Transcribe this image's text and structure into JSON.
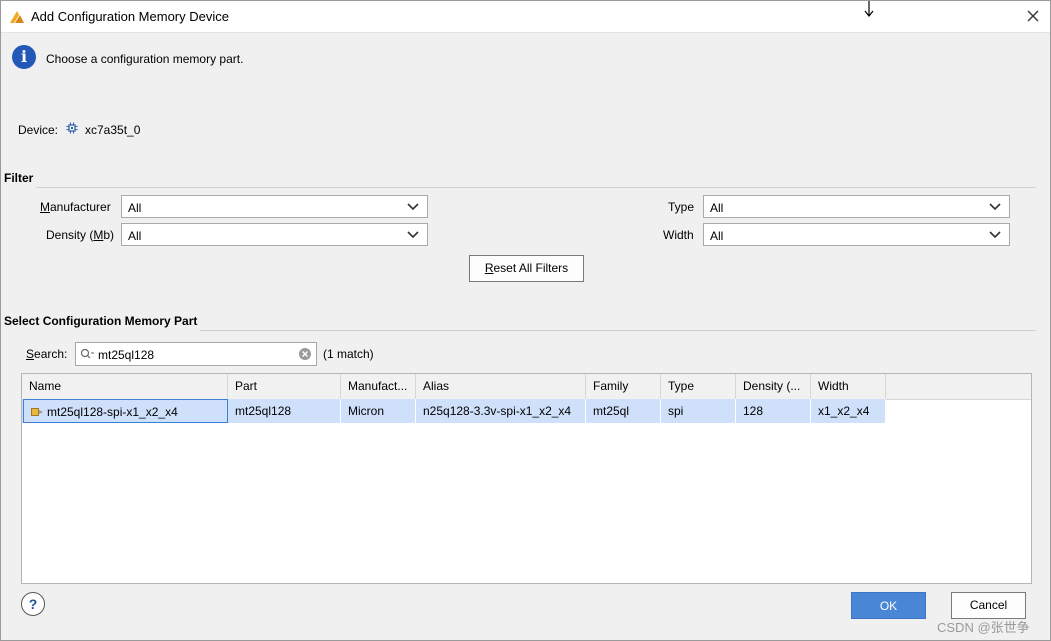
{
  "window": {
    "title": "Add Configuration Memory Device"
  },
  "info": {
    "message": "Choose a configuration memory part."
  },
  "device": {
    "label": "Device:",
    "value": "xc7a35t_0"
  },
  "filter": {
    "section_title": "Filter",
    "manufacturer": {
      "label_pre": "",
      "label_key": "M",
      "label_post": "anufacturer",
      "value": "All"
    },
    "density": {
      "label_pre": "Density (",
      "label_key": "M",
      "label_post": "b)",
      "value": "All"
    },
    "type": {
      "label": "Type",
      "value": "All"
    },
    "width": {
      "label": "Width",
      "value": "All"
    },
    "reset_key": "R",
    "reset_rest": "eset All Filters"
  },
  "select": {
    "section_title": "Select Configuration Memory Part",
    "search_label_key": "S",
    "search_label_rest": "earch:",
    "search_value": "mt25ql128",
    "match_count": "(1 match)"
  },
  "table": {
    "columns": [
      "Name",
      "Part",
      "Manufact...",
      "Alias",
      "Family",
      "Type",
      "Density (...",
      "Width"
    ],
    "rows": [
      [
        "mt25ql128-spi-x1_x2_x4",
        "mt25ql128",
        "Micron",
        "n25q128-3.3v-spi-x1_x2_x4",
        "mt25ql",
        "spi",
        "128",
        "x1_x2_x4"
      ]
    ]
  },
  "footer": {
    "help": "?",
    "ok": "OK",
    "cancel": "Cancel"
  },
  "watermark": "CSDN @张世争",
  "colors": {
    "accent": "#4a86d6",
    "selected_row": "#cfe0fa",
    "info_blue": "#2358b8"
  }
}
